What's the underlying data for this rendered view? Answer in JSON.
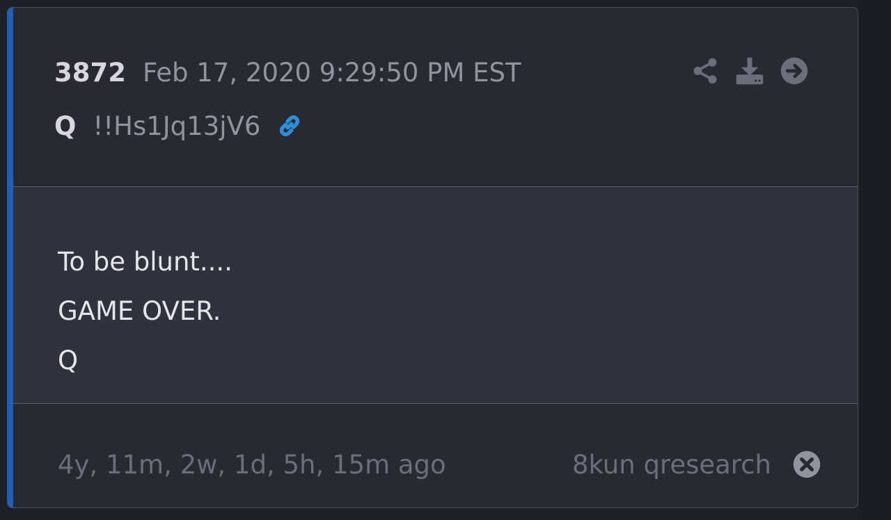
{
  "post": {
    "number": "3872",
    "date": "Feb 17, 2020 9:29:50 PM EST",
    "author": "Q",
    "tripcode": "!!Hs1Jq13jV6",
    "link_icon": "link-icon",
    "actions": [
      {
        "name": "share-icon"
      },
      {
        "name": "download-icon"
      },
      {
        "name": "arrow-right-circle-icon"
      }
    ],
    "body_lines": [
      "To be blunt....",
      "GAME OVER.",
      "Q"
    ],
    "elapsed": "4y, 11m, 2w, 1d, 5h, 15m ago",
    "source": "8kun qresearch",
    "close_icon": "close-circle-icon"
  },
  "colors": {
    "accent": "#1f5fbf",
    "link": "#2f8fd6",
    "muted": "#8f949f",
    "footer_text": "#6a6f7b",
    "card_bg": "#272a33",
    "body_bg": "#2f333d"
  }
}
